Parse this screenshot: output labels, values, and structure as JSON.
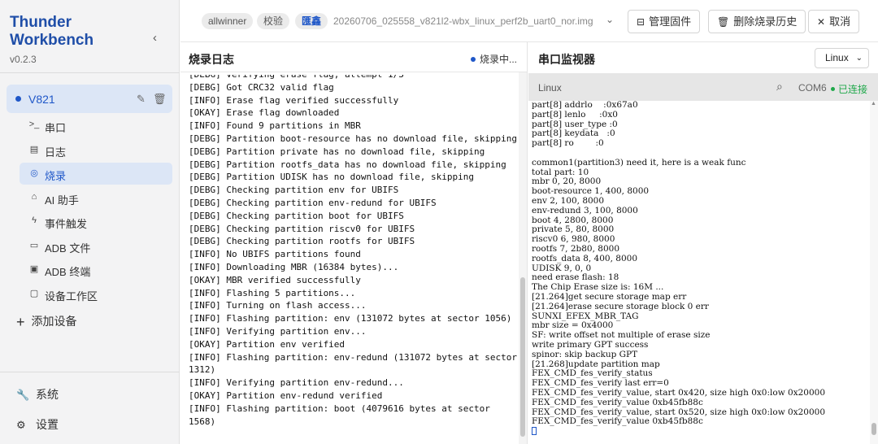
{
  "sidebar": {
    "brand": "Thunder Workbench",
    "version": "v0.2.3",
    "collapse_icon": "‹",
    "device": {
      "name": "V821"
    },
    "nav": [
      {
        "label": "串口",
        "icon": "terminal-icon",
        "glyph": ">_"
      },
      {
        "label": "日志",
        "icon": "document-icon",
        "glyph": "▤"
      },
      {
        "label": "烧录",
        "icon": "flash-icon",
        "glyph": "◎"
      },
      {
        "label": "AI 助手",
        "icon": "robot-icon",
        "glyph": "⌂"
      },
      {
        "label": "事件触发",
        "icon": "lightning-icon",
        "glyph": "ϟ"
      },
      {
        "label": "ADB 文件",
        "icon": "folder-icon",
        "glyph": "▭"
      },
      {
        "label": "ADB 终端",
        "icon": "terminal-box-icon",
        "glyph": "▣"
      },
      {
        "label": "设备工作区",
        "icon": "workspace-folder-icon",
        "glyph": "▢"
      }
    ],
    "add_device": "添加设备",
    "system": "系统",
    "settings": "设置"
  },
  "topbar": {
    "chips": [
      "allwinner",
      "校验",
      "匯鑫"
    ],
    "filename": "20260706_025558_v821l2-wbx_linux_perf2b_uart0_nor.img",
    "manage_firmware": "管理固件",
    "delete_history": "删除烧录历史",
    "cancel": "取消"
  },
  "log": {
    "title": "烧录日志",
    "status": "烧录中...",
    "lines": [
      "[DEBG] Verifying erase flag, attempt 1/3",
      "[DEBG] Got CRC32 valid flag",
      "[INFO] Erase flag verified successfully",
      "[OKAY] Erase flag downloaded",
      "[INFO] Found 9 partitions in MBR",
      "[DEBG] Partition boot-resource has no download file, skipping",
      "[DEBG] Partition private has no download file, skipping",
      "[DEBG] Partition rootfs_data has no download file, skipping",
      "[DEBG] Partition UDISK has no download file, skipping",
      "[DEBG] Checking partition env for UBIFS",
      "[DEBG] Checking partition env-redund for UBIFS",
      "[DEBG] Checking partition boot for UBIFS",
      "[DEBG] Checking partition riscv0 for UBIFS",
      "[DEBG] Checking partition rootfs for UBIFS",
      "[INFO] No UBIFS partitions found",
      "[INFO] Downloading MBR (16384 bytes)...",
      "[OKAY] MBR verified successfully",
      "[INFO] Flashing 5 partitions...",
      "[INFO] Turning on flash access...",
      "[INFO] Flashing partition: env (131072 bytes at sector 1056)",
      "[INFO] Verifying partition env...",
      "[OKAY] Partition env verified",
      "[INFO] Flashing partition: env-redund (131072 bytes at sector 1312)",
      "[INFO] Verifying partition env-redund...",
      "[OKAY] Partition env-redund verified",
      "[INFO] Flashing partition: boot (4079616 bytes at sector 1568)"
    ]
  },
  "serial": {
    "title": "串口监视器",
    "os_select": "Linux",
    "filter_label": "Linux",
    "port": "COM6",
    "connection": "已连接",
    "lines": [
      "part[8] addrlo    :0x67a0",
      "part[8] lenlo     :0x0",
      "part[8] user_type :0",
      "part[8] keydata   :0",
      "part[8] ro        :0",
      "",
      "common1(partition3) need it, here is a weak func",
      "total part: 10",
      "mbr 0, 20, 8000",
      "boot-resource 1, 400, 8000",
      "env 2, 100, 8000",
      "env-redund 3, 100, 8000",
      "boot 4, 2800, 8000",
      "private 5, 80, 8000",
      "riscv0 6, 980, 8000",
      "rootfs 7, 2b80, 8000",
      "rootfs_data 8, 400, 8000",
      "UDISK 9, 0, 0",
      "need erase flash: 18",
      "The Chip Erase size is: 16M ...",
      "[21.264]get secure storage map err",
      "[21.264]erase secure storage block 0 err",
      "SUNXI_EFEX_MBR_TAG",
      "mbr size = 0x4000",
      "SF: write offset not multiple of erase size",
      "write primary GPT success",
      "spinor: skip backup GPT",
      "[21.268]update partition map",
      "FEX_CMD_fes_verify_status",
      "FEX_CMD_fes_verify last err=0",
      "FEX_CMD_fes_verify_value, start 0x420, size high 0x0:low 0x20000",
      "FEX_CMD_fes_verify_value 0xb45fb88c",
      "FEX_CMD_fes_verify_value, start 0x520, size high 0x0:low 0x20000",
      "FEX_CMD_fes_verify_value 0xb45fb88c"
    ]
  },
  "colors": {
    "accent": "#1f57c8",
    "connected": "#1fa84a",
    "sidebar_bg": "#f3f3f4",
    "active_bg": "#dce6f6"
  }
}
